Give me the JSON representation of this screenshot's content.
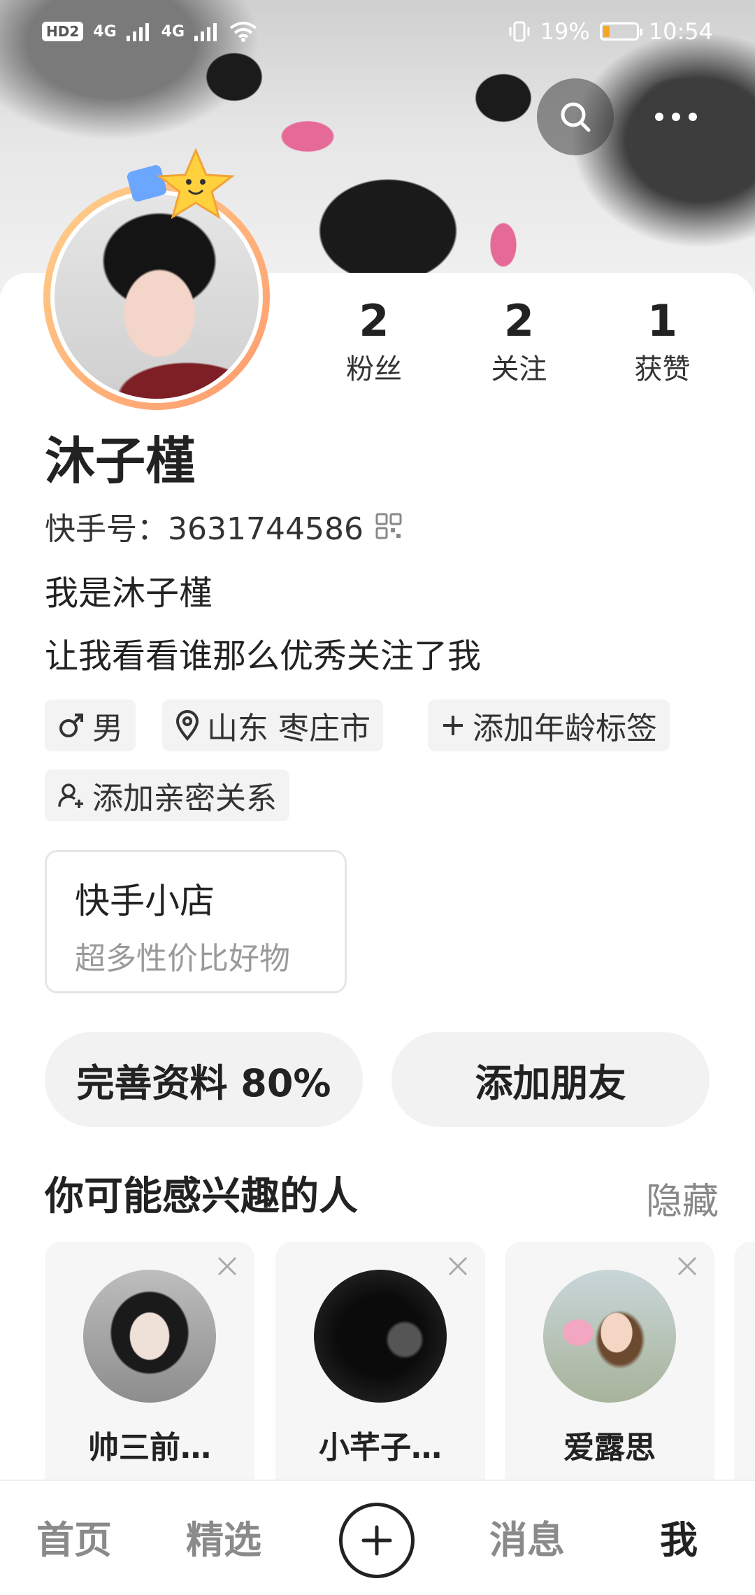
{
  "status_bar": {
    "left_badges": [
      "HD2",
      "4G",
      "4G"
    ],
    "battery_percent": "19%",
    "battery_level": 0.19,
    "time": "10:54"
  },
  "header": {
    "icons": [
      "search-icon",
      "more-icon"
    ]
  },
  "profile": {
    "stats": [
      {
        "value": "2",
        "label": "粉丝"
      },
      {
        "value": "2",
        "label": "关注"
      },
      {
        "value": "1",
        "label": "获赞"
      }
    ],
    "name": "沐子槿",
    "kuaishou_id": "快手号：3631744586",
    "bio_line1": "我是沐子槿",
    "bio_line2": "让我看看谁那么优秀关注了我",
    "tags": {
      "gender": "男",
      "location": "山东 枣庄市",
      "add_age": "添加年龄标签",
      "add_relation": "添加亲密关系"
    }
  },
  "shop": {
    "title": "快手小店",
    "subtitle": "超多性价比好物"
  },
  "actions": {
    "complete_profile": "完善资料 80%",
    "add_friend": "添加朋友"
  },
  "recommend": {
    "title": "你可能感兴趣的人",
    "hide": "隐藏",
    "users": [
      {
        "name": "帅三前…"
      },
      {
        "name": "小芊子…"
      },
      {
        "name": "爱露思"
      }
    ]
  },
  "bottom_nav": {
    "home": "首页",
    "featured": "精选",
    "messages": "消息",
    "me": "我"
  }
}
